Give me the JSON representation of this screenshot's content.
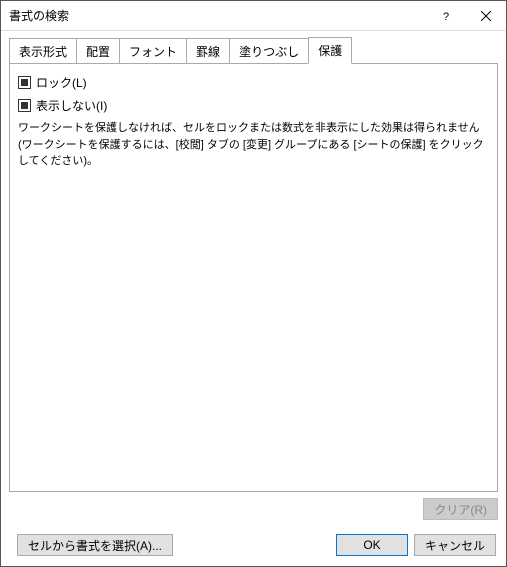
{
  "window": {
    "title": "書式の検索"
  },
  "tabs": {
    "t0": "表示形式",
    "t1": "配置",
    "t2": "フォント",
    "t3": "罫線",
    "t4": "塗りつぶし",
    "t5": "保護"
  },
  "protection": {
    "lock_label": "ロック(L)",
    "hidden_label": "表示しない(I)",
    "note": "ワークシートを保護しなければ、セルをロックまたは数式を非表示にした効果は得られません (ワークシートを保護するには、[校閲] タブの [変更] グループにある [シートの保護] をクリックしてください)。"
  },
  "buttons": {
    "clear": "クリア(R)",
    "choose_format": "セルから書式を選択(A)...",
    "ok": "OK",
    "cancel": "キャンセル"
  }
}
